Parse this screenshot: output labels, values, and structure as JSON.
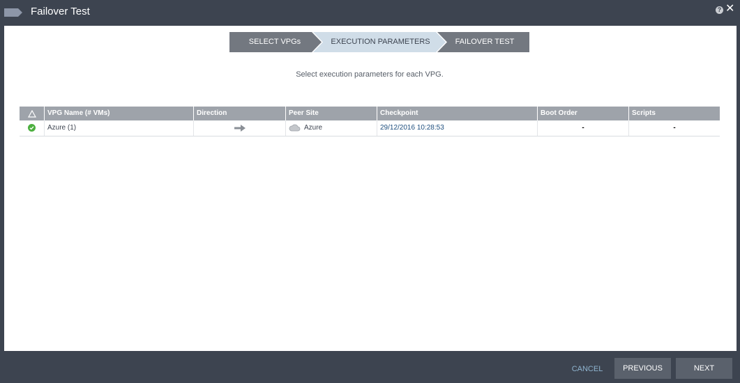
{
  "window": {
    "title": "Failover Test",
    "help_glyph": "?",
    "close_glyph": "✕"
  },
  "wizard": {
    "steps": [
      {
        "label": "SELECT VPGs",
        "state": "done"
      },
      {
        "label": "EXECUTION PARAMETERS",
        "state": "active"
      },
      {
        "label": "FAILOVER TEST",
        "state": "pending"
      }
    ]
  },
  "instruction": "Select execution parameters for each VPG.",
  "grid": {
    "columns": [
      "",
      "VPG Name (# VMs)",
      "Direction",
      "Peer Site",
      "Checkpoint",
      "Boot Order",
      "Scripts"
    ],
    "rows": [
      {
        "status_icon": "check-circle-icon",
        "vpg_name": "Azure (1)",
        "direction_icon": "arrow-right-icon",
        "peer_site": "Azure",
        "peer_site_icon": "cloud-icon",
        "checkpoint": "29/12/2016 10:28:53",
        "boot_order": "-",
        "scripts": "-"
      }
    ]
  },
  "footer": {
    "cancel": "CANCEL",
    "previous": "PREVIOUS",
    "next": "NEXT"
  },
  "colors": {
    "chrome": "#3d4450",
    "wizard_step": "#737880",
    "wizard_active": "#d0dde8",
    "grid_header": "#9ea3aa",
    "status_ok": "#4caf3f",
    "link": "#1d4e7e"
  }
}
